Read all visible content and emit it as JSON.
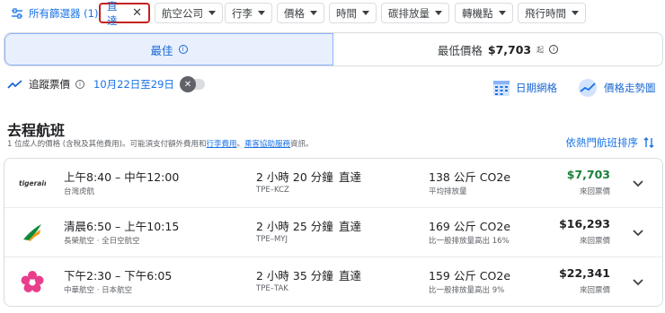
{
  "filters": {
    "all_filters_label": "所有篩選器 (1)",
    "active_chip": "直達",
    "chips": [
      "航空公司",
      "行李",
      "價格",
      "時間",
      "碳排放量",
      "轉機點",
      "飛行時間"
    ]
  },
  "sort": {
    "best_label": "最佳",
    "cheapest_label": "最低價格",
    "cheapest_price": "$7,703",
    "cheapest_unit": "起"
  },
  "tracking": {
    "label": "追蹤票價",
    "dates": "10月22日至29日"
  },
  "tools": {
    "date_grid": "日期網格",
    "price_graph": "價格走勢圖"
  },
  "section": {
    "title": "去程航班",
    "note_prefix": "1 位成人的價格 (含稅及其他費用)。可能須支付額外費用和",
    "note_link1": "行李費用",
    "note_mid": "。",
    "note_link2": "乘客協助服務",
    "note_suffix": "資訊。",
    "sort_link": "依熱門航班排序"
  },
  "flights": [
    {
      "times": "上午8:40 – 中午12:00",
      "airline": "台灣虎航",
      "duration": "2 小時 20 分鐘",
      "route": "TPE–KCZ",
      "stops": "直達",
      "co2": "138 公斤 CO2e",
      "co2_note": "平均排放量",
      "price": "$7,703",
      "price_note": "來回票價",
      "logo_text": "tigerair"
    },
    {
      "times": "清晨6:50 – 上午10:15",
      "airline": "長榮航空 · 全日空航空",
      "duration": "2 小時 25 分鐘",
      "route": "TPE–MYJ",
      "stops": "直達",
      "co2": "169 公斤 CO2e",
      "co2_note": "比一般排放量高出 16%",
      "price": "$16,293",
      "price_note": "來回票價"
    },
    {
      "times": "下午2:30 – 下午6:05",
      "airline": "中華航空 · 日本航空",
      "duration": "2 小時 35 分鐘",
      "route": "TPE–TAK",
      "stops": "直達",
      "co2": "159 公斤 CO2e",
      "co2_note": "比一般排放量高出 9%",
      "price": "$22,341",
      "price_note": "來回票價"
    }
  ],
  "colors": {
    "accent": "#1a73e8",
    "green_price": "#188038",
    "active_outline": "#c5221f"
  }
}
